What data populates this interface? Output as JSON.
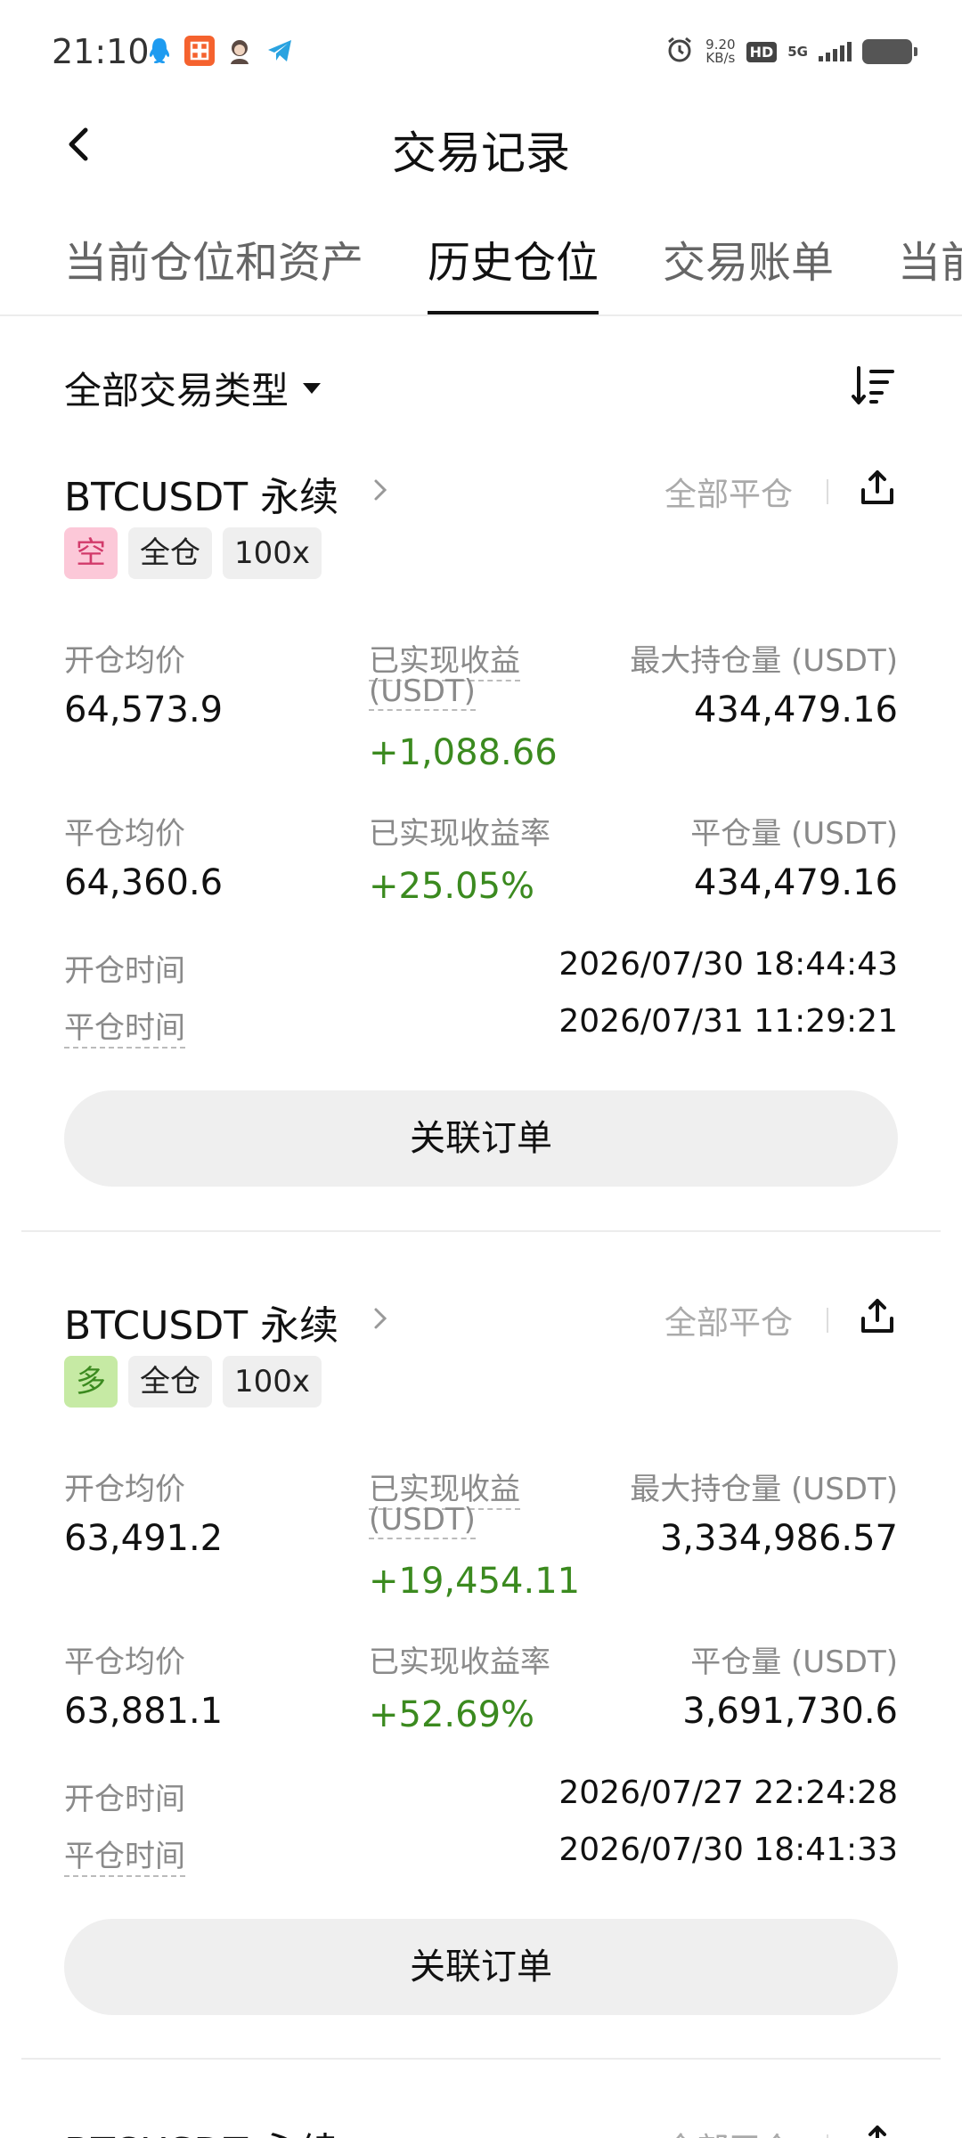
{
  "status_bar": {
    "time": "21:10",
    "net_speed_value": "9.20",
    "net_speed_unit": "KB/s",
    "hd_label": "HD",
    "network_label": "5G",
    "apps": [
      {
        "name": "qq-icon",
        "color": "#1e9bf0"
      },
      {
        "name": "app-icon-orange",
        "color": "#f5622e"
      },
      {
        "name": "avatar-app-icon",
        "color": "#5b4a43"
      },
      {
        "name": "telegram-icon",
        "color": "#2aa3e0"
      }
    ]
  },
  "header": {
    "title": "交易记录",
    "back_icon": "chevron-left-icon"
  },
  "tabs": [
    {
      "label": "当前仓位和资产",
      "active": false
    },
    {
      "label": "历史仓位",
      "active": true
    },
    {
      "label": "交易账单",
      "active": false
    },
    {
      "label": "当前",
      "active": false
    }
  ],
  "filter": {
    "label": "全部交易类型",
    "sort_icon": "sort-icon"
  },
  "cards": [
    {
      "symbol": "BTCUSDT 永续",
      "close_all": "全部平仓",
      "side_tag": "空",
      "margin_tag": "全仓",
      "leverage_tag": "100x",
      "open_avg_label": "开仓均价",
      "open_avg": "64,573.9",
      "pnl_label_1": "已实现收益",
      "pnl_label_2": "(USDT)",
      "pnl": "+1,088.66",
      "max_pos_label": "最大持仓量 (USDT)",
      "max_pos": "434,479.16",
      "close_avg_label": "平仓均价",
      "close_avg": "64,360.6",
      "pnl_rate_label": "已实现收益率",
      "pnl_rate": "+25.05%",
      "close_vol_label": "平仓量 (USDT)",
      "close_vol": "434,479.16",
      "open_time_label": "开仓时间",
      "open_time": "2026/07/30 18:44:43",
      "close_time_label": "平仓时间",
      "close_time": "2026/07/31 11:29:21",
      "link_button": "关联订单"
    },
    {
      "symbol": "BTCUSDT 永续",
      "close_all": "全部平仓",
      "side_tag": "多",
      "margin_tag": "全仓",
      "leverage_tag": "100x",
      "open_avg_label": "开仓均价",
      "open_avg": "63,491.2",
      "pnl_label_1": "已实现收益",
      "pnl_label_2": "(USDT)",
      "pnl": "+19,454.11",
      "max_pos_label": "最大持仓量 (USDT)",
      "max_pos": "3,334,986.57",
      "close_avg_label": "平仓均价",
      "close_avg": "63,881.1",
      "pnl_rate_label": "已实现收益率",
      "pnl_rate": "+52.69%",
      "close_vol_label": "平仓量 (USDT)",
      "close_vol": "3,691,730.6",
      "open_time_label": "开仓时间",
      "open_time": "2026/07/27 22:24:28",
      "close_time_label": "平仓时间",
      "close_time": "2026/07/30 18:41:33",
      "link_button": "关联订单"
    },
    {
      "symbol": "BTCUSDT 永续",
      "close_all": "全部平仓"
    }
  ],
  "colors": {
    "positive": "#3b8a1f",
    "short_tag_bg": "#fcc8d8",
    "long_tag_bg": "#c6eaa4",
    "muted_text": "#8a8a8a"
  }
}
